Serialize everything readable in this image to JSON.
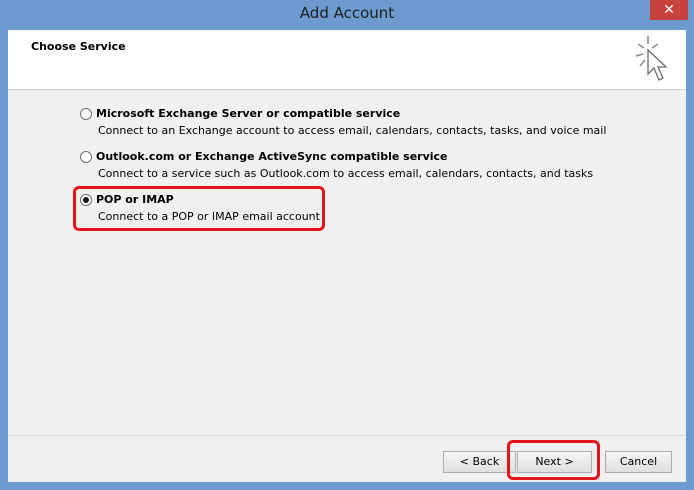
{
  "window": {
    "title": "Add Account",
    "close_glyph": "✕"
  },
  "header": {
    "title": "Choose Service",
    "icon": "cursor-sparkle-icon"
  },
  "options": [
    {
      "label": "Microsoft Exchange Server or compatible service",
      "description": "Connect to an Exchange account to access email, calendars, contacts, tasks, and voice mail",
      "selected": false
    },
    {
      "label": "Outlook.com or Exchange ActiveSync compatible service",
      "description": "Connect to a service such as Outlook.com to access email, calendars, contacts, and tasks",
      "selected": false
    },
    {
      "label": "POP or IMAP",
      "description": "Connect to a POP or IMAP email account",
      "selected": true
    }
  ],
  "buttons": {
    "back": "< Back",
    "next": "Next >",
    "cancel": "Cancel"
  },
  "colors": {
    "highlight": "#e4141c",
    "frame": "#6d9bcf"
  }
}
